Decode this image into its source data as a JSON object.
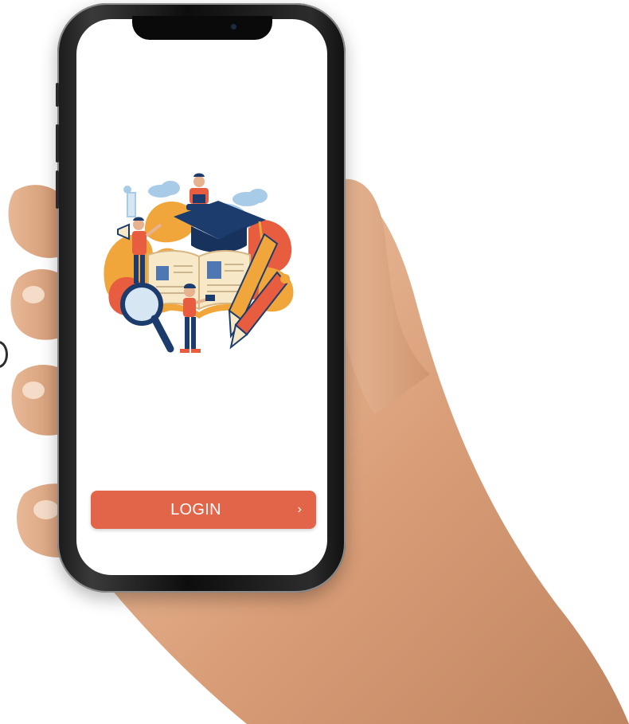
{
  "login_screen": {
    "login_button_label": "LOGIN",
    "login_chevron": "›"
  },
  "colors": {
    "accent": "#e2654a",
    "navy": "#1d3c6e",
    "orange": "#f0a63a",
    "red_orange": "#e85d3f",
    "light_blue": "#a8cbe8",
    "cream": "#f7e9c7",
    "skin": "#e7b28f"
  },
  "icons": {
    "login_chevron": "chevron-right-icon",
    "illustration": "education-illustration-icon"
  }
}
